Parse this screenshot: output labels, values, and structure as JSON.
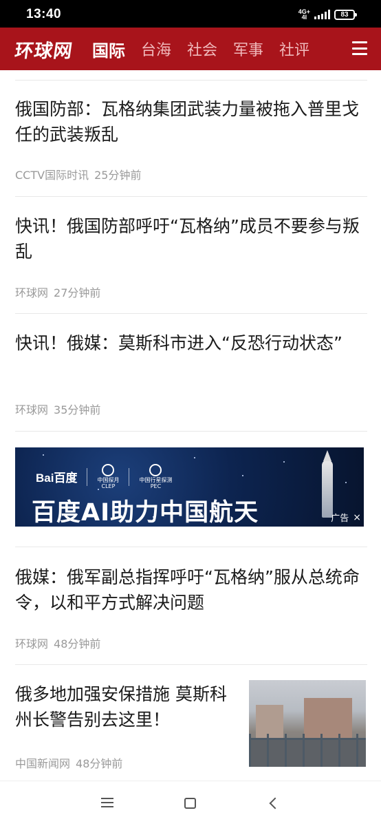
{
  "status_bar": {
    "time": "13:40",
    "network_top": "4G+",
    "network_bottom": "4I",
    "battery": "83"
  },
  "header": {
    "logo": "环球网",
    "nav": [
      "国际",
      "台海",
      "社会",
      "军事",
      "社评"
    ],
    "active_nav": "国际"
  },
  "news": [
    {
      "title": "俄国防部：瓦格纳集团武装力量被拖入普里戈任的武装叛乱",
      "source": "CCTV国际时讯",
      "time": "25分钟前"
    },
    {
      "title": "快讯！俄国防部呼吁“瓦格纳”成员不要参与叛乱",
      "source": "环球网",
      "time": "27分钟前"
    },
    {
      "title": "快讯！俄媒：莫斯科市进入“反恐行动状态”",
      "source": "环球网",
      "time": "35分钟前"
    },
    {
      "title": "俄媒：俄军副总指挥呼吁“瓦格纳”服从总统命令，以和平方式解决问题",
      "source": "环球网",
      "time": "48分钟前"
    },
    {
      "title": "俄多地加强安保措施 莫斯科州长警告别去这里！",
      "source": "中国新闻网",
      "time": "48分钟前"
    }
  ],
  "ad": {
    "brand": "Bai百度",
    "partner_1": "中国探月",
    "partner_1_sub": "CLEP",
    "partner_2": "中国行星探测",
    "partner_2_sub": "PEC",
    "headline": "百度AI助力中国航天",
    "badge": "广告",
    "close": "×"
  }
}
